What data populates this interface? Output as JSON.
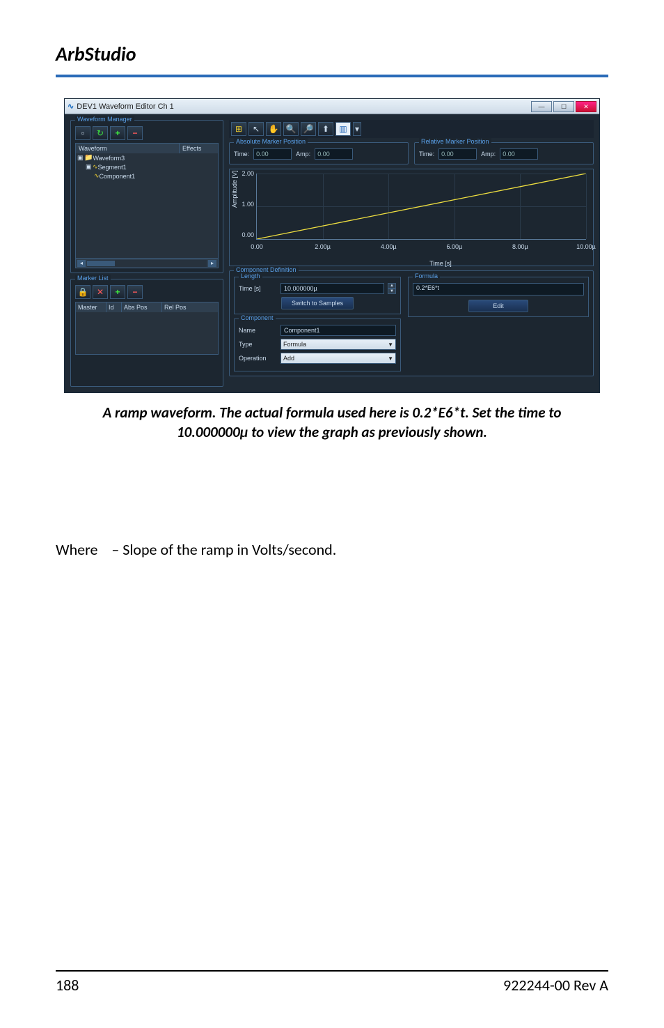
{
  "header": {
    "title": "ArbStudio"
  },
  "window": {
    "title": "DEV1 Waveform Editor Ch 1"
  },
  "waveform_manager": {
    "legend": "Waveform Manager",
    "cols": [
      "Waveform",
      "Effects"
    ],
    "tree": [
      "Waveform3",
      "Segment1",
      "Component1"
    ]
  },
  "marker_list": {
    "legend": "Marker List",
    "cols": [
      "Master",
      "Id",
      "Abs Pos",
      "Rel Pos"
    ]
  },
  "marker_pos": {
    "abs_legend": "Absolute Marker Position",
    "rel_legend": "Relative Marker Position",
    "time_label": "Time:",
    "amp_label": "Amp:",
    "abs_time": "0.00",
    "abs_amp": "0.00",
    "rel_time": "0.00",
    "rel_amp": "0.00"
  },
  "chart_data": {
    "type": "line",
    "formula_full": "0.2*E6*t",
    "x": [
      0.0,
      2e-06,
      4e-06,
      6e-06,
      8e-06,
      1e-05
    ],
    "values": [
      0.0,
      0.4,
      0.8,
      1.2,
      1.6,
      2.0
    ],
    "ylabel": "Amplitude [V]",
    "xlabel": "Time [s]",
    "xlim": [
      0,
      1e-05
    ],
    "ylim": [
      0,
      2.0
    ],
    "yticks": [
      "0.00",
      "1.00",
      "2.00"
    ],
    "xticks": [
      "0.00",
      "2.00µ",
      "4.00µ",
      "6.00µ",
      "8.00µ",
      "10.00µ"
    ]
  },
  "component_def": {
    "legend": "Component Definition",
    "length": {
      "legend": "Length",
      "time_label": "Time [s]",
      "time_value": "10.000000µ",
      "switch_btn": "Switch to Samples"
    },
    "formula": {
      "legend": "Formula",
      "value": "0.2*E6*t",
      "edit_btn": "Edit"
    },
    "component": {
      "legend": "Component",
      "name_label": "Name",
      "name_value": "Component1",
      "type_label": "Type",
      "type_value": "Formula",
      "op_label": "Operation",
      "op_value": "Add"
    }
  },
  "caption": {
    "line1": "A ramp waveform. The actual formula used here is 0.2*E6*t. Set the time to",
    "line2": "10.000000µ to view the graph as previously shown."
  },
  "body": {
    "where": "Where",
    "slope": "– Slope of the ramp in Volts/second."
  },
  "footer": {
    "page": "188",
    "docid": "922244-00 Rev A"
  }
}
